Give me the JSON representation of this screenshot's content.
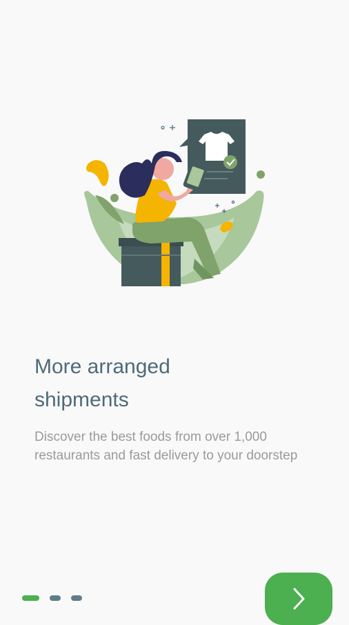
{
  "onboarding": {
    "title_line1": "More arranged",
    "title_line2": "shipments",
    "description": "Discover the best foods from over 1,000 restaurants and fast delivery to your doorstep"
  },
  "pager": {
    "page_count": 3,
    "active_index": 0
  },
  "next_button": {
    "icon": "chevron-right-icon"
  },
  "colors": {
    "accent": "#4caf50",
    "inactive_dot": "#607d8b",
    "title": "#4e6a7a",
    "description": "#9a9a9a",
    "background": "#f9f9f9"
  }
}
